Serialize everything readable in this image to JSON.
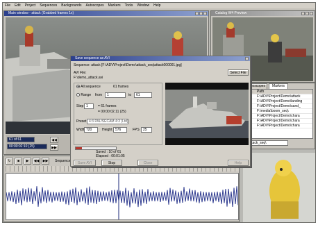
{
  "menu": [
    "File",
    "Edit",
    "Project",
    "Sequences",
    "Backgrounds",
    "Autoscopes",
    "Markers",
    "Tools",
    "Window",
    "Help"
  ],
  "windows": {
    "main": {
      "title": "Main window - attack (Grabbed frames 1x)"
    },
    "preview": {
      "title": "Catalog W4 Preview"
    },
    "save": {
      "title": "Save sequence as AVI",
      "sequence": "Sequence: attack [F:\\ADV\\Project\\Demo\\attack_seq\\attack000001.jpg]",
      "avi_file_label": "AVI File:",
      "avi_file_value": "F:\\demo_attack.avi",
      "select_file": "Select File",
      "all_sequence": "All sequence",
      "frames_count": "61 frames",
      "range": "Range",
      "from": "from",
      "from_value": "1",
      "to": "to",
      "to_value": "61",
      "step_label": "Step",
      "step_value": "1",
      "step_frames": "= 61 frames",
      "duration": "= 00:00:02.11 (25)",
      "preset_label": "Preset",
      "preset_value": "4:3 PAL/SECAM 4:3 (Ltd)",
      "width_label": "Width",
      "width_value": "720",
      "height_label": "Height",
      "height_value": "576",
      "fps_label": "FPS",
      "fps_value": "25",
      "saved": "Saved : 10 of 61",
      "elapsed": "Elapsed : 00:01:05",
      "progress": 0.16,
      "buttons": {
        "save": "Save AVI",
        "stop": "Stop",
        "close": "Close",
        "help": "Help"
      }
    }
  },
  "main_counter": {
    "frame": "61 of 61",
    "time": "00:00:02:10 (25)"
  },
  "tabs": {
    "scopes": "Autoscopes",
    "markers": "Markers"
  },
  "list_header": {
    "c1": "Fr...",
    "c2": "Path"
  },
  "list_rows": [
    {
      "n": "",
      "p": "F:\\ADV\\Project\\Demo\\attack"
    },
    {
      "n": "",
      "p": "F:\\ADV\\Project\\Demo\\landing"
    },
    {
      "n": "",
      "p": "F:\\ADV\\Project\\Demo\\sand_"
    },
    {
      "n": "",
      "p": "F:\\media\\boom_seq\\"
    },
    {
      "n": "",
      "p": "F:\\ADV\\Project\\Demo\\chara"
    },
    {
      "n": "",
      "p": "F:\\ADV\\Project\\Demo\\chara"
    },
    {
      "n": "",
      "p": "F:\\ADV\\Project\\Demo\\chara"
    }
  ],
  "list_footer": "attack_seq\\",
  "timeline": {
    "label": "Sequence: attack 0 frames - 00:00:02.08"
  },
  "icons": [
    "play-icon",
    "stop-icon",
    "rewind-icon",
    "forward-icon",
    "loop-icon",
    "window-minimize-icon",
    "window-maximize-icon",
    "window-close-icon"
  ]
}
